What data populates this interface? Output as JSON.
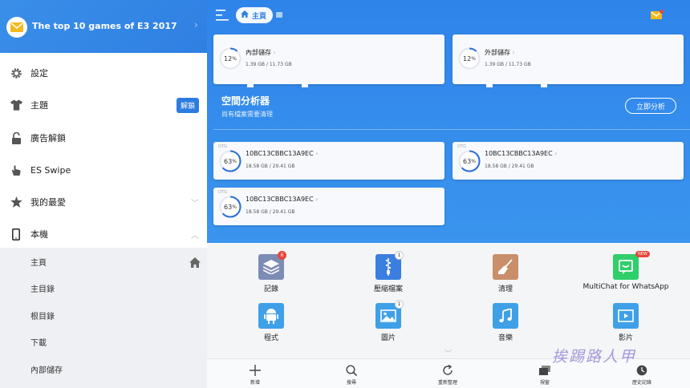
{
  "sidebar": {
    "header_title": "The top 10 games of E3 2017",
    "items": [
      {
        "label": "設定"
      },
      {
        "label": "主題",
        "badge": "解鎖"
      },
      {
        "label": "廣告解鎖"
      },
      {
        "label": "ES Swipe"
      },
      {
        "label": "我的最愛"
      },
      {
        "label": "本機"
      }
    ],
    "sub_items": [
      {
        "label": "主頁"
      },
      {
        "label": "主目錄"
      },
      {
        "label": "根目錄"
      },
      {
        "label": "下載"
      },
      {
        "label": "內部儲存"
      }
    ]
  },
  "header": {
    "breadcrumb": "主頁"
  },
  "storage_top": [
    {
      "name": "內部儲存",
      "percent": 12,
      "unit": "%",
      "usage": "1.39 GB / 11.73 GB"
    },
    {
      "name": "外部儲存",
      "percent": 12,
      "unit": "%",
      "usage": "1.39 GB / 11.73 GB"
    }
  ],
  "analyzer": {
    "title": "空間分析器",
    "subtitle": "尚有檔案需要清理",
    "button": "立即分析"
  },
  "storage_usb": [
    {
      "name": "10BC13CBBC13A9EC",
      "percent": 63,
      "unit": "%",
      "usage": "18.58 GB / 29.41 GB"
    },
    {
      "name": "10BC13CBBC13A9EC",
      "percent": 63,
      "unit": "%",
      "usage": "18.58 GB / 29.41 GB"
    },
    {
      "name": "10BC13CBBC13A9EC",
      "percent": 63,
      "unit": "%",
      "usage": "18.58 GB / 29.41 GB"
    }
  ],
  "apps": [
    {
      "label": "記錄",
      "count": "6"
    },
    {
      "label": "壓縮檔案",
      "count": "1"
    },
    {
      "label": "清理"
    },
    {
      "label": "MultiChat for WhatsApp",
      "tag": "NEW"
    },
    {
      "label": "程式"
    },
    {
      "label": "圖片",
      "count": "1"
    },
    {
      "label": "音樂"
    },
    {
      "label": "影片"
    }
  ],
  "toolbar": [
    {
      "label": "新增"
    },
    {
      "label": "搜尋"
    },
    {
      "label": "重新整理"
    },
    {
      "label": "視窗"
    },
    {
      "label": "歷史記錄"
    }
  ],
  "watermark": "挨踢路人甲",
  "colors": {
    "accent": "#2f7fe2",
    "ring": "#2d6fd6",
    "badge_red": "#e8453c"
  }
}
